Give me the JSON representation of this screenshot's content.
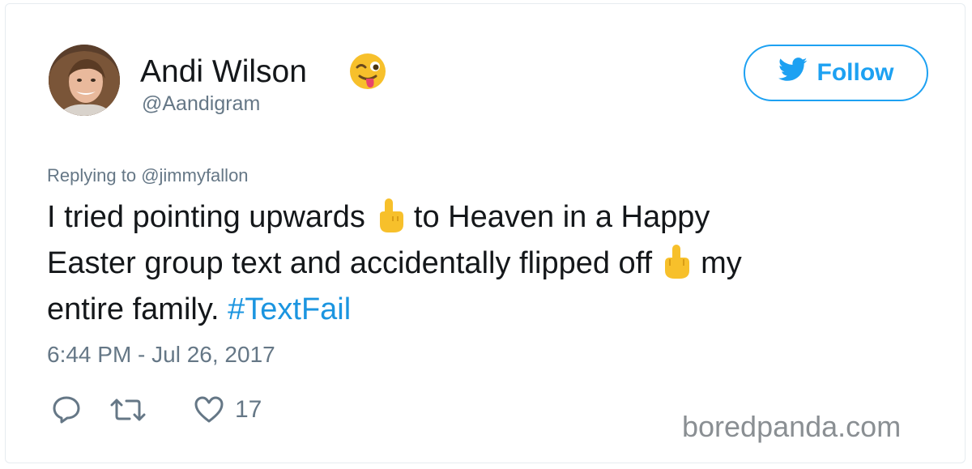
{
  "user": {
    "display_name": "Andi Wilson",
    "handle": "@Aandigram",
    "name_emoji": "winking-face-with-tongue"
  },
  "follow_button": {
    "label": "Follow",
    "icon": "twitter-bird-icon"
  },
  "tweet": {
    "replying_prefix": "Replying to ",
    "replying_to": "@jimmyfallon",
    "line1_a": "I tried pointing upwards",
    "line1_b": "to Heaven in a Happy",
    "line2_a": "Easter group text and accidentally flipped off",
    "line2_b": "my",
    "line3_a": "entire family. ",
    "hashtag": "#TextFail",
    "timestamp": "6:44 PM - Jul 26, 2017"
  },
  "actions": {
    "reply_icon": "reply-icon",
    "retweet_icon": "retweet-icon",
    "like_icon": "heart-icon",
    "like_count": "17"
  },
  "watermark": "boredpanda.com",
  "colors": {
    "accent": "#1da1f2",
    "hashtag": "#1b95e0",
    "secondary_text": "#657786",
    "text": "#14171a",
    "emoji_yellow": "#f7c02b"
  }
}
